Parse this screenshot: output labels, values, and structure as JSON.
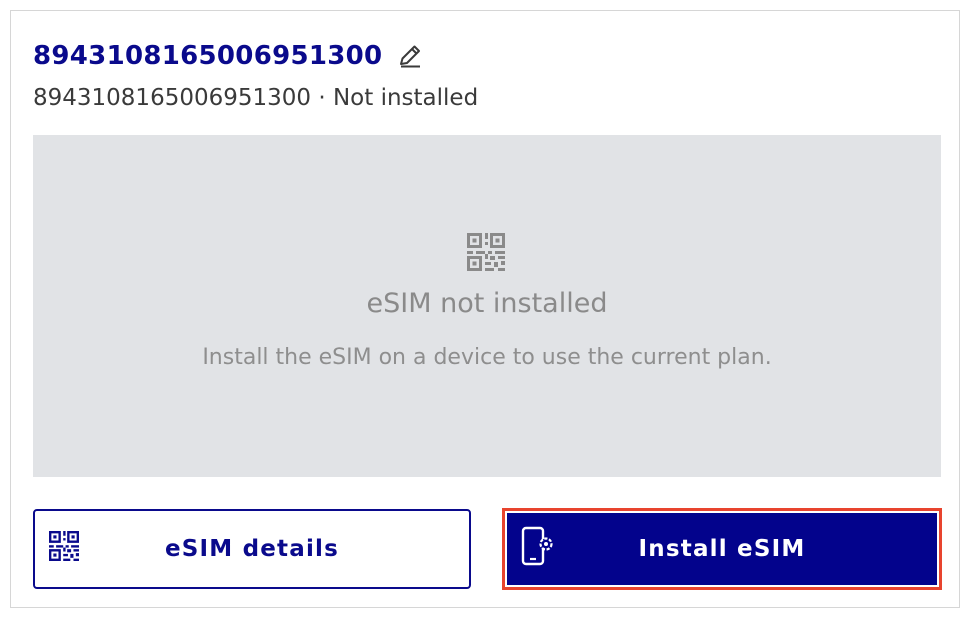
{
  "card": {
    "title": "8943108165006951300",
    "edit_icon": "pencil-icon",
    "subtitle": "8943108165006951300 · Not installed"
  },
  "status_panel": {
    "icon": "qr-code-icon",
    "title": "eSIM not installed",
    "description": "Install the eSIM on a device to use the current plan."
  },
  "actions": {
    "details_label": "eSIM details",
    "details_icon": "qr-code-icon",
    "install_label": "Install eSIM",
    "install_icon": "phone-settings-icon"
  },
  "colors": {
    "brand": "#03038c",
    "highlight": "#e8442e",
    "panel_bg": "#e1e3e6"
  }
}
